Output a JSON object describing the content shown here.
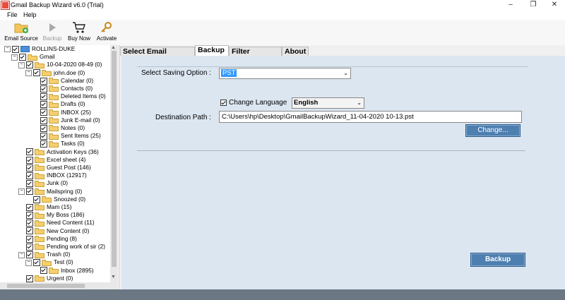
{
  "window": {
    "title": "Gmail Backup Wizard v6.0 (Trial)",
    "minimize": "–",
    "maximize": "❐",
    "close": "✕"
  },
  "menu": [
    "File",
    "Help"
  ],
  "toolbar": [
    {
      "label": "Email Source",
      "icon": "email-source-icon",
      "enabled": true
    },
    {
      "label": "Backup",
      "icon": "backup-play-icon",
      "enabled": false
    },
    {
      "label": "Buy Now",
      "icon": "cart-icon",
      "enabled": true
    },
    {
      "label": "Activate",
      "icon": "key-icon",
      "enabled": true
    }
  ],
  "tree": {
    "nodes": [
      {
        "label": "ROLLINS-DUKE",
        "level": 0,
        "exp": "−",
        "icon": "pc"
      },
      {
        "label": "Gmail",
        "level": 1,
        "exp": "−",
        "icon": "gmail"
      },
      {
        "label": "10-04-2020 08-49 (0)",
        "level": 2,
        "exp": "−",
        "icon": "folder"
      },
      {
        "label": "john.doe (0)",
        "level": 3,
        "exp": "−",
        "icon": "folder"
      },
      {
        "label": "Calendar (0)",
        "level": 4,
        "exp": "",
        "icon": "folder"
      },
      {
        "label": "Contacts (0)",
        "level": 4,
        "exp": "",
        "icon": "folder"
      },
      {
        "label": "Deleted Items (0)",
        "level": 4,
        "exp": "",
        "icon": "folder"
      },
      {
        "label": "Drafts (0)",
        "level": 4,
        "exp": "",
        "icon": "folder"
      },
      {
        "label": "INBOX (25)",
        "level": 4,
        "exp": "",
        "icon": "folder"
      },
      {
        "label": "Junk E-mail (0)",
        "level": 4,
        "exp": "",
        "icon": "folder"
      },
      {
        "label": "Notes (0)",
        "level": 4,
        "exp": "",
        "icon": "folder"
      },
      {
        "label": "Sent Items (25)",
        "level": 4,
        "exp": "",
        "icon": "folder"
      },
      {
        "label": "Tasks (0)",
        "level": 4,
        "exp": "",
        "icon": "folder"
      },
      {
        "label": "Activation Keys (36)",
        "level": 2,
        "exp": "",
        "icon": "folder"
      },
      {
        "label": "Excel sheet (4)",
        "level": 2,
        "exp": "",
        "icon": "folder"
      },
      {
        "label": "Guest Post (146)",
        "level": 2,
        "exp": "",
        "icon": "folder"
      },
      {
        "label": "INBOX (12917)",
        "level": 2,
        "exp": "",
        "icon": "folder"
      },
      {
        "label": "Junk (0)",
        "level": 2,
        "exp": "",
        "icon": "folder"
      },
      {
        "label": "Mailspring (0)",
        "level": 2,
        "exp": "−",
        "icon": "folder"
      },
      {
        "label": "Snoozed (0)",
        "level": 3,
        "exp": "",
        "icon": "folder"
      },
      {
        "label": "Mam (15)",
        "level": 2,
        "exp": "",
        "icon": "folder"
      },
      {
        "label": "My Boss (186)",
        "level": 2,
        "exp": "",
        "icon": "folder"
      },
      {
        "label": "Need Content (11)",
        "level": 2,
        "exp": "",
        "icon": "folder"
      },
      {
        "label": "New Content (0)",
        "level": 2,
        "exp": "",
        "icon": "folder"
      },
      {
        "label": "Pending (8)",
        "level": 2,
        "exp": "",
        "icon": "folder"
      },
      {
        "label": "Pending work of sir (2)",
        "level": 2,
        "exp": "",
        "icon": "folder"
      },
      {
        "label": "Trash (0)",
        "level": 2,
        "exp": "−",
        "icon": "folder"
      },
      {
        "label": "Test (0)",
        "level": 3,
        "exp": "−",
        "icon": "folder"
      },
      {
        "label": "Inbox (2895)",
        "level": 4,
        "exp": "",
        "icon": "folder"
      },
      {
        "label": "Urgent (0)",
        "level": 2,
        "exp": "",
        "icon": "folder"
      }
    ]
  },
  "tabs": [
    {
      "label": "Select Email Source",
      "active": false
    },
    {
      "label": "Backup",
      "active": true
    },
    {
      "label": "Filter Options",
      "active": false
    },
    {
      "label": "About",
      "active": false
    }
  ],
  "backup": {
    "saving_option_label": "Select Saving Option :",
    "saving_option_value": "PST",
    "change_language_label": "Change Language",
    "language_value": "English",
    "destination_label": "Destination Path :",
    "destination_value": "C:\\Users\\hp\\Desktop\\GmailBackupWizard_11-04-2020 10-13.pst",
    "change_button": "Change...",
    "backup_button": "Backup"
  }
}
